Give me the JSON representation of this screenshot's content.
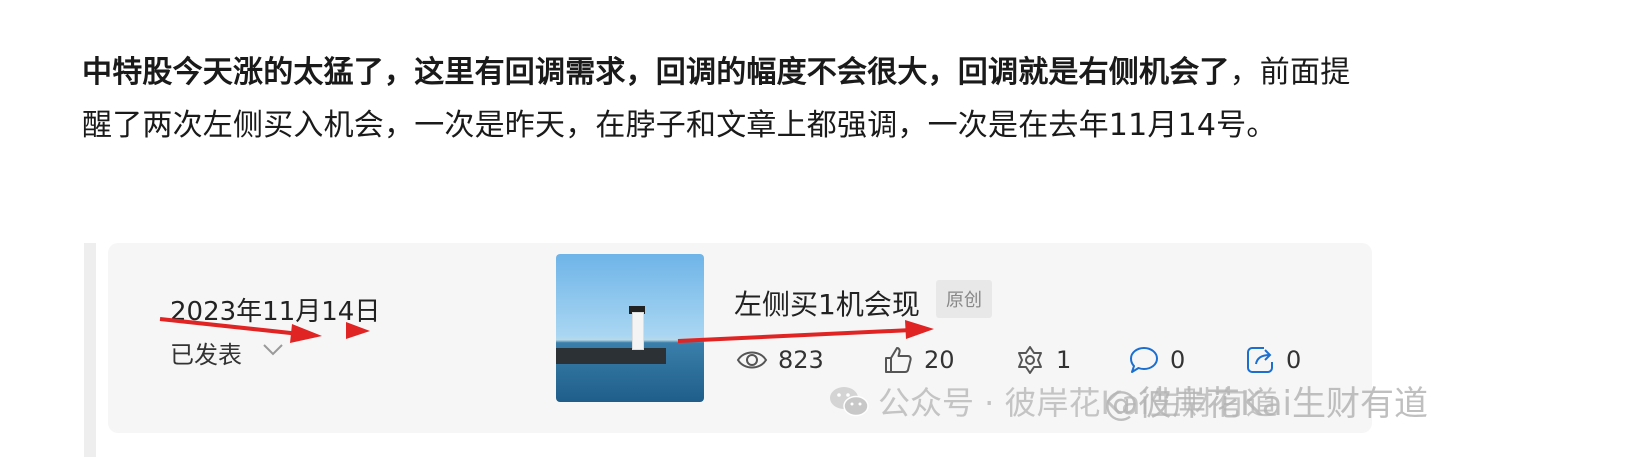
{
  "article": {
    "bold_text": "中特股今天涨的太猛了，这里有回调需求，回调的幅度不会很大，回调就是右侧机会了",
    "normal_text": "，前面提醒了两次左侧买入机会，一次是昨天，在脖子和文章上都强调，一次是在去年11月14号。"
  },
  "card": {
    "date": "2023年11月14日",
    "status": "已发表",
    "title": "左侧买1机会现",
    "badge": "原创",
    "stats": {
      "views": "823",
      "likes": "20",
      "shares": "1",
      "comments": "0",
      "forwards": "0"
    }
  },
  "watermark": {
    "text": "公众号 · 彼岸花Kai生财有道",
    "overlay": "@彼岸花Kai生财有道"
  },
  "colors": {
    "arrow": "#e02424",
    "card_bg": "#f6f6f7",
    "icon": "#555555"
  },
  "icons": [
    "chevron-down-icon",
    "eye-icon",
    "thumbs-up-icon",
    "share-icon",
    "comment-icon",
    "forward-icon",
    "wechat-icon"
  ]
}
